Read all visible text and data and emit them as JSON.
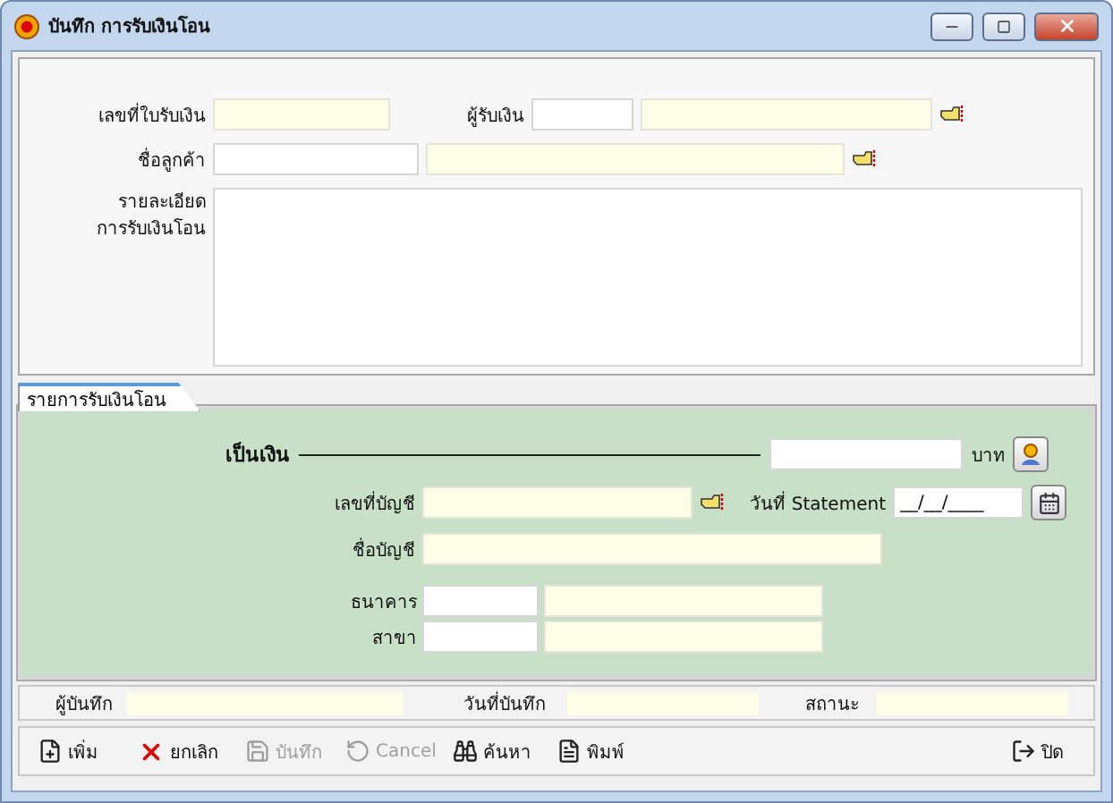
{
  "window": {
    "title": "บันทึก การรับเงินโอน"
  },
  "header": {
    "receipt_number": {
      "label": "เลขที่ใบรับเงิน",
      "fields": [
        {
          "readonly": true
        }
      ]
    },
    "payee": {
      "label": "ผู้รับเงิน",
      "fields": [
        {
          "readonly": false
        },
        {
          "readonly": true
        }
      ]
    },
    "customer": {
      "label": "ชื่อลูกค้า",
      "fields": [
        {
          "readonly": false
        },
        {
          "readonly": true
        }
      ]
    },
    "details": {
      "label_lines": [
        "รายละเอียด",
        "การรับเงินโอน"
      ]
    }
  },
  "tabs": [
    {
      "label": "รายการรับเงินโอน",
      "selected": true
    }
  ],
  "transfer": {
    "amount": {
      "label": "เป็นเงิน",
      "unit": "บาท",
      "fields": [
        {
          "readonly": false
        }
      ]
    },
    "account_number": {
      "label": "เลขที่บัญชี",
      "fields": [
        {
          "readonly": true
        }
      ]
    },
    "statement_date": {
      "label": "วันที่ Statement",
      "value": "__/__/____"
    },
    "account_name": {
      "label": "ชื่อบัญชี",
      "fields": [
        {
          "readonly": true
        }
      ]
    },
    "bank": {
      "label": "ธนาคาร",
      "fields": [
        {
          "readonly": false
        },
        {
          "readonly": true
        }
      ]
    },
    "branch": {
      "label": "สาขา",
      "fields": [
        {
          "readonly": false
        },
        {
          "readonly": true
        }
      ]
    }
  },
  "info_bar": [
    {
      "label": "ผู้บันทึก"
    },
    {
      "label": "วันที่บันทึก"
    },
    {
      "label": "สถานะ"
    }
  ],
  "toolbar": [
    {
      "label": "เพิ่ม",
      "kind": "new",
      "disabled": false
    },
    {
      "label": "ยกเลิก",
      "kind": "cancel",
      "disabled": false
    },
    {
      "label": "บันทึก",
      "kind": "save",
      "disabled": true
    },
    {
      "label": "Cancel",
      "kind": "undo",
      "disabled": true
    },
    {
      "label": "ค้นหา",
      "kind": "find",
      "disabled": false
    },
    {
      "label": "พิมพ์",
      "kind": "print",
      "disabled": false
    },
    {
      "label": "ปิด",
      "kind": "exit",
      "disabled": false
    }
  ]
}
